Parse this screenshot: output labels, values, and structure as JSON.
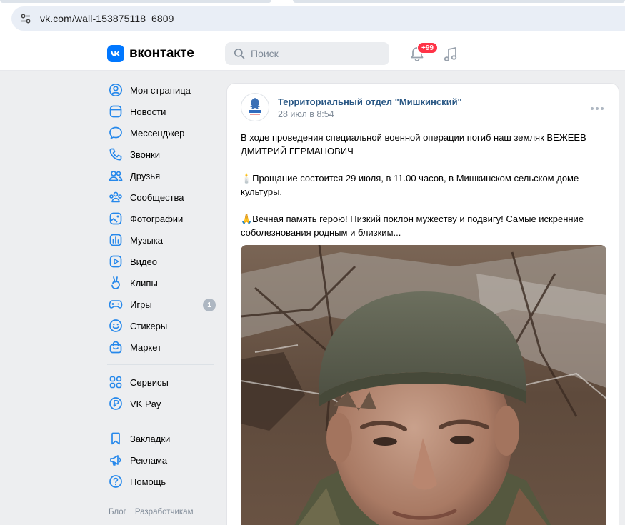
{
  "browser": {
    "url": "vk.com/wall-153875118_6809"
  },
  "header": {
    "logo_text": "вконтакте",
    "search_placeholder": "Поиск",
    "notifications_badge": "+99",
    "brand_color": "#0077ff"
  },
  "sidebar": {
    "items": [
      {
        "label": "Моя страница",
        "icon": "user-circle-icon"
      },
      {
        "label": "Новости",
        "icon": "news-icon"
      },
      {
        "label": "Мессенджер",
        "icon": "message-icon"
      },
      {
        "label": "Звонки",
        "icon": "phone-icon"
      },
      {
        "label": "Друзья",
        "icon": "friends-icon"
      },
      {
        "label": "Сообщества",
        "icon": "communities-icon"
      },
      {
        "label": "Фотографии",
        "icon": "photo-icon"
      },
      {
        "label": "Музыка",
        "icon": "music-icon"
      },
      {
        "label": "Видео",
        "icon": "video-icon"
      },
      {
        "label": "Клипы",
        "icon": "clips-icon"
      },
      {
        "label": "Игры",
        "icon": "gamepad-icon",
        "count": "1"
      },
      {
        "label": "Стикеры",
        "icon": "sticker-icon"
      },
      {
        "label": "Маркет",
        "icon": "market-bag-icon"
      }
    ],
    "items2": [
      {
        "label": "Сервисы",
        "icon": "services-icon"
      },
      {
        "label": "VK Pay",
        "icon": "vkpay-icon"
      }
    ],
    "items3": [
      {
        "label": "Закладки",
        "icon": "bookmark-icon"
      },
      {
        "label": "Реклама",
        "icon": "megaphone-icon"
      },
      {
        "label": "Помощь",
        "icon": "help-icon"
      }
    ],
    "footer": [
      "Блог",
      "Разработчикам"
    ]
  },
  "post": {
    "author": "Территориальный отдел \"Мишкинский\"",
    "date": "28 июл в 8:54",
    "paragraphs": [
      "В ходе проведения специальной военной операции погиб наш земляк ВЕЖЕЕВ ДМИТРИЙ ГЕРМАНОВИЧ",
      "🕯️Прощание состоится 29 июля, в 11.00 часов, в Мишкинском сельском доме культуры.",
      "🙏Вечная память герою! Низкий поклон мужеству и подвигу! Самые искренние соболезнования родным и близким..."
    ]
  }
}
